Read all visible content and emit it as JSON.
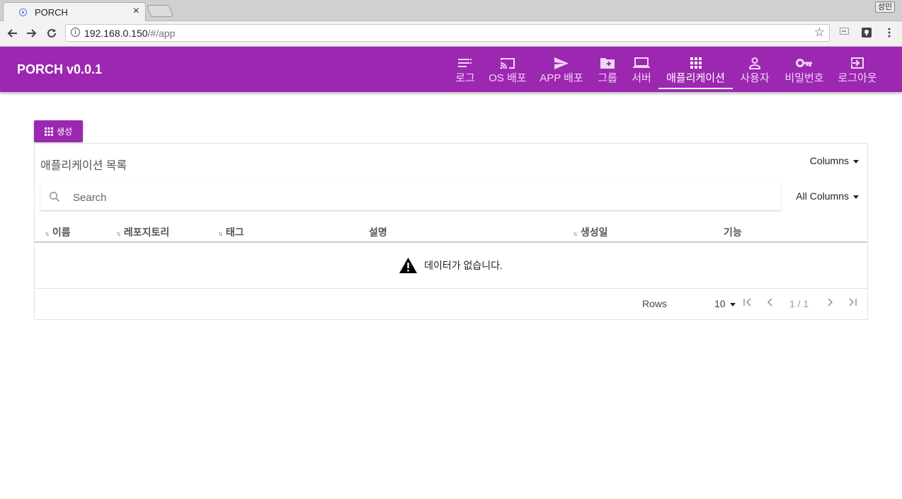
{
  "browser": {
    "tab_title": "PORCH",
    "tab_close": "×",
    "profile": "성민",
    "url_host": "192.168.0.150",
    "url_path": "/#/app"
  },
  "app": {
    "brand": "PORCH v0.0.1",
    "menu": [
      {
        "label": "로그",
        "icon": "list-icon"
      },
      {
        "label": "OS 배포",
        "icon": "cast-icon"
      },
      {
        "label": "APP 배포",
        "icon": "send-icon"
      },
      {
        "label": "그룹",
        "icon": "folder-plus-icon"
      },
      {
        "label": "서버",
        "icon": "laptop-icon"
      },
      {
        "label": "애플리케이션",
        "icon": "apps-grid-icon",
        "active": true
      },
      {
        "label": "사용자",
        "icon": "person-icon"
      },
      {
        "label": "비밀번호",
        "icon": "key-icon"
      },
      {
        "label": "로그아웃",
        "icon": "exit-icon"
      }
    ],
    "accent": "#9c27b0"
  },
  "page": {
    "create_label": "생성",
    "panel_title": "애플리케이션 목록",
    "columns_label": "Columns",
    "search_placeholder": "Search",
    "all_columns_label": "All Columns",
    "table": {
      "headers": [
        "이름",
        "레포지토리",
        "태그",
        "설명",
        "생성일",
        "기능"
      ],
      "empty_message": "데이터가 없습니다."
    },
    "pagination": {
      "rows_label": "Rows",
      "rows_value": "10",
      "page_info": "1 / 1"
    }
  }
}
